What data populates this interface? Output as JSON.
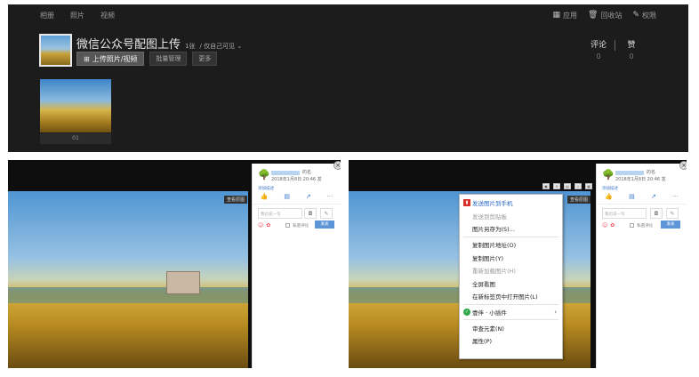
{
  "nav": [
    "相册",
    "照片",
    "视频"
  ],
  "topright": {
    "apps": "应用",
    "recycle": "回收站",
    "permission": "权限"
  },
  "album": {
    "title": "微信公众号配图上传",
    "count": "1张",
    "visibility": "/ 仅自己可见",
    "upload_button": "上传照片/视频",
    "batch_button": "批量管理",
    "more_button": "更多"
  },
  "stats": {
    "comments_label": "评论",
    "comments_value": "0",
    "likes_label": "赞",
    "likes_value": "0"
  },
  "thumb_caption": "01",
  "viewer_left": {
    "tag": "查看原图",
    "name_suffix": "的名",
    "date": "2018年1月8日 20:46 发",
    "add_desc": "添加描述",
    "comment_placeholder": "我也说一句",
    "private_label": "私密评论",
    "send": "发表"
  },
  "viewer_right": {
    "tag": "查看原图",
    "name_suffix": "的名",
    "date": "2018年1月8日 20:46 发",
    "add_desc": "添加描述",
    "comment_placeholder": "我也说一句",
    "private_label": "私密评论",
    "send": "发表"
  },
  "context_menu": [
    {
      "label": "发送图片到手机",
      "state": "highlight",
      "icon": "phone-icon"
    },
    {
      "label": "发送到剪贴板",
      "state": "disabled"
    },
    {
      "label": "图片另存为(S)...",
      "state": "normal"
    },
    {
      "sep": true
    },
    {
      "label": "复制图片地址(O)",
      "state": "normal"
    },
    {
      "label": "复制图片(Y)",
      "state": "normal"
    },
    {
      "label": "重新加载图片(H)",
      "state": "disabled"
    },
    {
      "label": "全屏看图",
      "state": "normal"
    },
    {
      "label": "在新标签页中打开图片(L)",
      "state": "normal"
    },
    {
      "sep": true
    },
    {
      "label": "壹伴 · 小插件",
      "state": "normal",
      "icon": "yiban-icon",
      "submenu": true
    },
    {
      "sep": true
    },
    {
      "label": "审查元素(N)",
      "state": "normal"
    },
    {
      "label": "属性(P)",
      "state": "normal"
    }
  ]
}
